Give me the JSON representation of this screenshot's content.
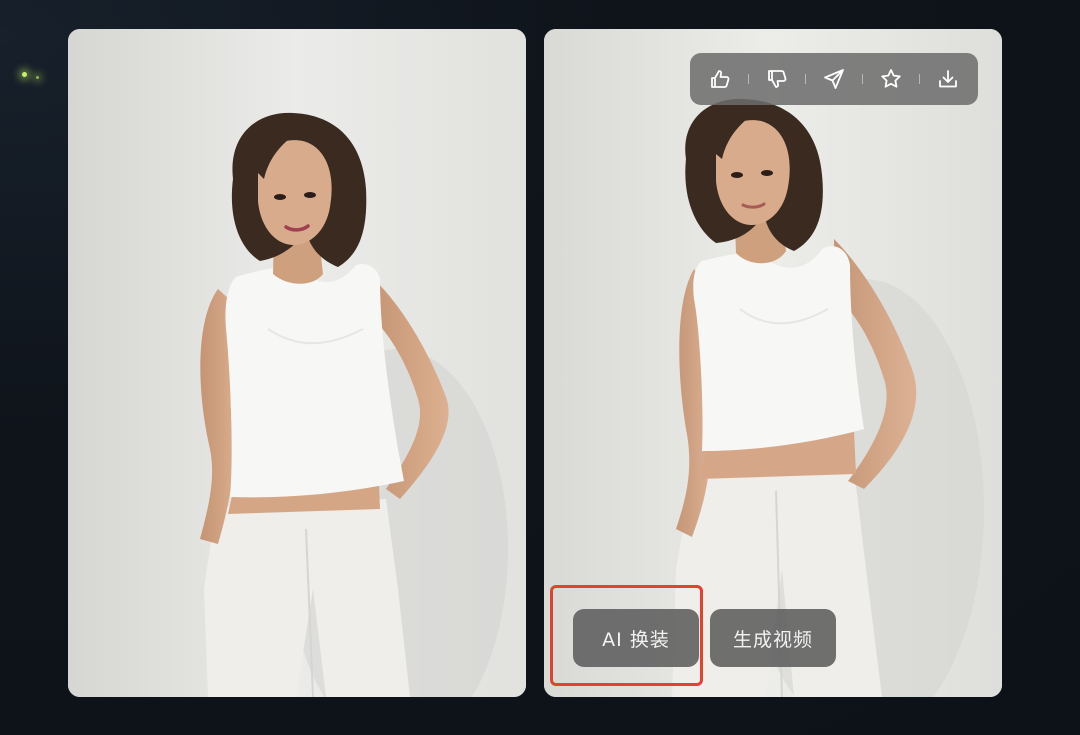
{
  "toolbar": {
    "items": [
      {
        "icon": "thumbs-up-icon"
      },
      {
        "icon": "thumbs-down-icon"
      },
      {
        "icon": "share-icon"
      },
      {
        "icon": "star-icon"
      },
      {
        "icon": "download-icon"
      }
    ]
  },
  "actions": {
    "outfit_label": "AI 换装",
    "video_label": "生成视频"
  },
  "colors": {
    "background": "#0f141b",
    "highlight": "#e2432c",
    "button_bg": "#606060",
    "toolbar_bg": "#6c6c6c"
  }
}
